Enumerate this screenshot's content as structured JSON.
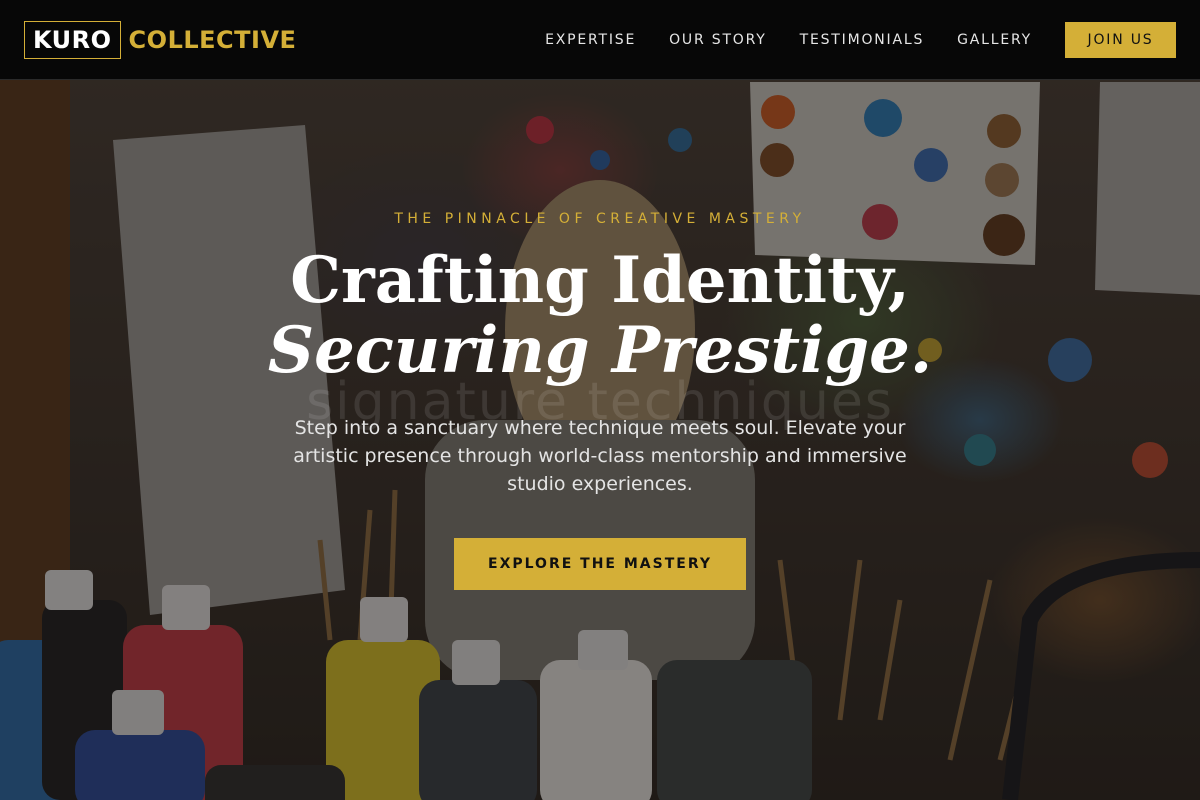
{
  "nav": {
    "logo_box": "KURO",
    "logo_word": "COLLECTIVE",
    "links": [
      "EXPERTISE",
      "OUR STORY",
      "TESTIMONIALS",
      "GALLERY"
    ],
    "cta": "JOIN US"
  },
  "hero": {
    "eyebrow": "THE PINNACLE OF CREATIVE MASTERY",
    "headline_line1": "Crafting Identity,",
    "headline_line2": "Securing Prestige.",
    "ghost_text": "signature techniques",
    "subtext": "Step into a sanctuary where technique meets soul. Elevate your artistic presence through world-class mentorship and immersive studio experiences.",
    "cta": "EXPLORE THE MASTERY"
  },
  "colors": {
    "accent": "#d4af37",
    "nav_bg": "#070707",
    "text": "#ffffff"
  }
}
